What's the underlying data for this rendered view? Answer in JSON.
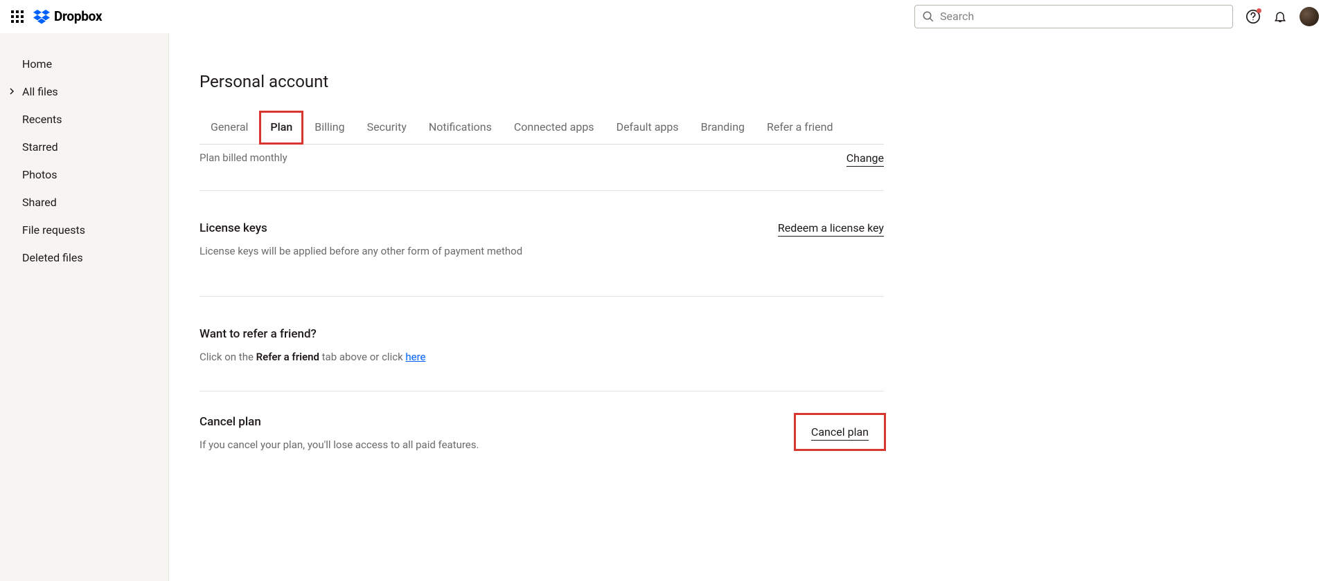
{
  "header": {
    "brand": "Dropbox",
    "search_placeholder": "Search"
  },
  "sidebar": {
    "items": [
      {
        "label": "Home"
      },
      {
        "label": "All files",
        "expandable": true
      },
      {
        "label": "Recents"
      },
      {
        "label": "Starred"
      },
      {
        "label": "Photos"
      },
      {
        "label": "Shared"
      },
      {
        "label": "File requests"
      },
      {
        "label": "Deleted files"
      }
    ]
  },
  "page": {
    "title": "Personal account"
  },
  "tabs": [
    {
      "label": "General"
    },
    {
      "label": "Plan",
      "active": true,
      "highlighted": true
    },
    {
      "label": "Billing"
    },
    {
      "label": "Security"
    },
    {
      "label": "Notifications"
    },
    {
      "label": "Connected apps"
    },
    {
      "label": "Default apps"
    },
    {
      "label": "Branding"
    },
    {
      "label": "Refer a friend"
    }
  ],
  "sections": {
    "billing": {
      "desc": "Plan billed monthly",
      "action": "Change"
    },
    "license": {
      "title": "License keys",
      "desc": "License keys will be applied before any other form of payment method",
      "action": "Redeem a license key"
    },
    "refer": {
      "title": "Want to refer a friend?",
      "desc_prefix": "Click on the ",
      "desc_bold": "Refer a friend",
      "desc_mid": " tab above or click ",
      "desc_link": "here"
    },
    "cancel": {
      "title": "Cancel plan",
      "desc": "If you cancel your plan, you'll lose access to all paid features.",
      "action": "Cancel plan"
    }
  }
}
